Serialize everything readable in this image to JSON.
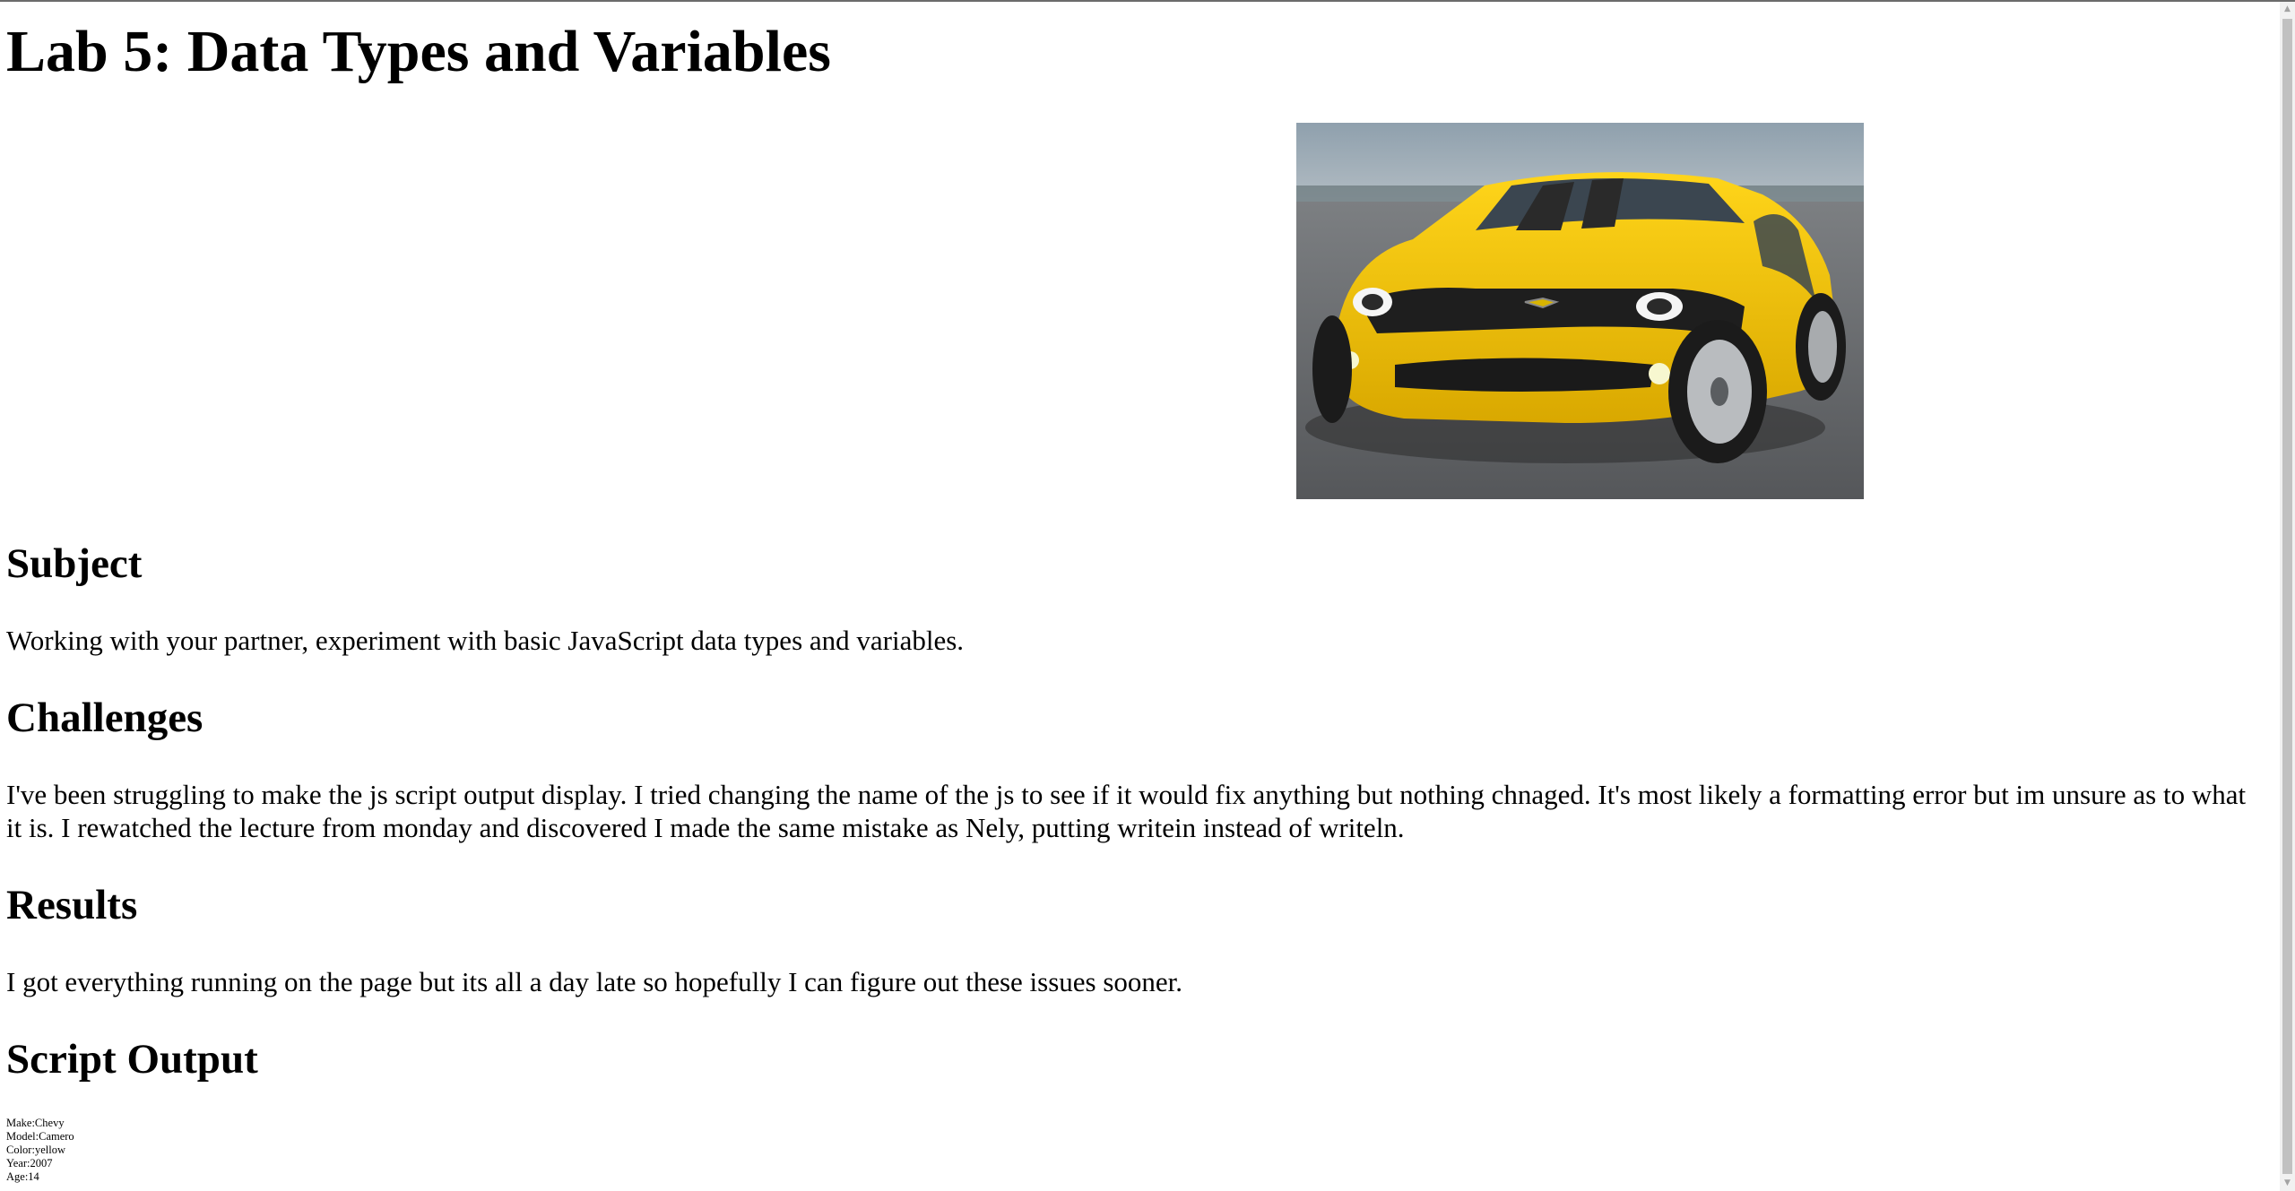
{
  "page": {
    "title": "Lab 5: Data Types and Variables"
  },
  "sections": {
    "subject": {
      "heading": "Subject",
      "text": "Working with your partner, experiment with basic JavaScript data types and variables."
    },
    "challenges": {
      "heading": "Challenges",
      "text": "I've been struggling to make the js script output display. I tried changing the name of the js to see if it would fix anything but nothing chnaged. It's most likely a formatting error but im unsure as to what it is. I rewatched the lecture from monday and discovered I made the same mistake as Nely, putting writein instead of writeln."
    },
    "results": {
      "heading": "Results",
      "text": "I got everything running on the page but its all a day late so hopefully I can figure out these issues sooner."
    },
    "script_output": {
      "heading": "Script Output",
      "lines": [
        "Make:Chevy",
        "Model:Camero",
        "Color:yellow",
        "Year:2007",
        "Age:14"
      ]
    }
  },
  "colors": {
    "car_body": "#f2c300",
    "car_stripe": "#2a2a2a",
    "sky": "#9aa6b0",
    "road": "#66686b"
  }
}
